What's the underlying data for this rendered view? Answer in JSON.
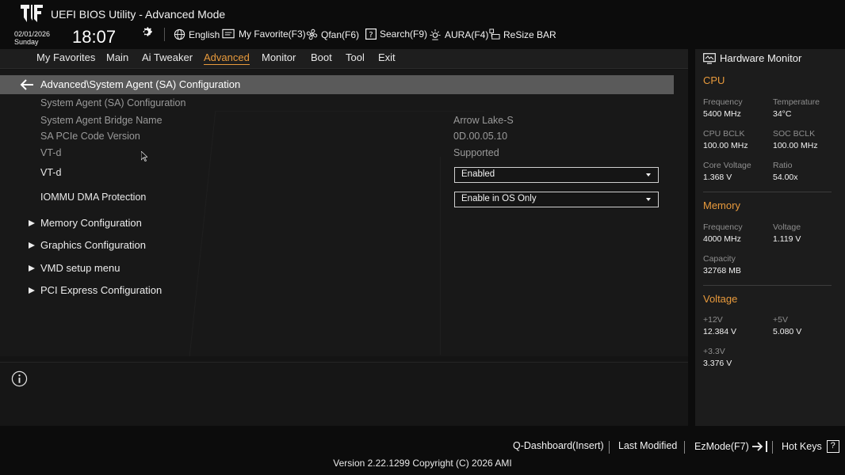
{
  "header": {
    "title": "UEFI BIOS Utility - Advanced Mode",
    "date": "02/01/2026",
    "day": "Sunday",
    "time": "18:07",
    "toolbar": [
      {
        "label": "English",
        "icon": "globe-icon"
      },
      {
        "label": "My Favorite(F3)",
        "icon": "favorite-icon"
      },
      {
        "label": "Qfan(F6)",
        "icon": "fan-icon"
      },
      {
        "label": "Search(F9)",
        "icon": "search-help-icon"
      },
      {
        "label": "AURA(F4)",
        "icon": "aura-icon"
      },
      {
        "label": "ReSize BAR",
        "icon": "resize-bar-icon"
      }
    ]
  },
  "tabs": [
    {
      "label": "My Favorites"
    },
    {
      "label": "Main"
    },
    {
      "label": "Ai Tweaker"
    },
    {
      "label": "Advanced",
      "active": true
    },
    {
      "label": "Monitor"
    },
    {
      "label": "Boot"
    },
    {
      "label": "Tool"
    },
    {
      "label": "Exit"
    }
  ],
  "breadcrumb": "Advanced\\System Agent (SA) Configuration",
  "content": {
    "section_title": "System Agent (SA) Configuration",
    "info_rows": [
      {
        "label": "System Agent Bridge Name",
        "value": "Arrow Lake-S"
      },
      {
        "label": "SA PCIe Code Version",
        "value": "0D.00.05.10"
      },
      {
        "label": "VT-d",
        "value": "Supported"
      }
    ],
    "settings": [
      {
        "label": "VT-d",
        "value": "Enabled"
      },
      {
        "label": "IOMMU DMA Protection",
        "value": "Enable in OS Only"
      }
    ],
    "submenus": [
      {
        "label": "Memory Configuration"
      },
      {
        "label": "Graphics Configuration"
      },
      {
        "label": "VMD setup menu"
      },
      {
        "label": "PCI Express Configuration"
      }
    ]
  },
  "hardware_monitor": {
    "title": "Hardware Monitor",
    "cpu": {
      "heading": "CPU",
      "frequency_label": "Frequency",
      "frequency": "5400 MHz",
      "temperature_label": "Temperature",
      "temperature": "34°C",
      "cpu_bclk_label": "CPU BCLK",
      "cpu_bclk": "100.00 MHz",
      "soc_bclk_label": "SOC BCLK",
      "soc_bclk": "100.00 MHz",
      "core_voltage_label": "Core Voltage",
      "core_voltage": "1.368 V",
      "ratio_label": "Ratio",
      "ratio": "54.00x"
    },
    "memory": {
      "heading": "Memory",
      "frequency_label": "Frequency",
      "frequency": "4000 MHz",
      "voltage_label": "Voltage",
      "voltage": "1.119 V",
      "capacity_label": "Capacity",
      "capacity": "32768 MB"
    },
    "voltage": {
      "heading": "Voltage",
      "v12_label": "+12V",
      "v12": "12.384 V",
      "v5_label": "+5V",
      "v5": "5.080 V",
      "v33_label": "+3.3V",
      "v33": "3.376 V"
    }
  },
  "footer": {
    "q_dashboard": "Q-Dashboard(Insert)",
    "last_modified": "Last Modified",
    "ezmode": "EzMode(F7)",
    "hot_keys": "Hot Keys",
    "hot_keys_key": "?",
    "version": "Version 2.22.1299 Copyright (C) 2026 AMI"
  },
  "colors": {
    "accent": "#e89a3c",
    "background": "#141414",
    "breadcrumb_bar": "#5a5a5a"
  }
}
